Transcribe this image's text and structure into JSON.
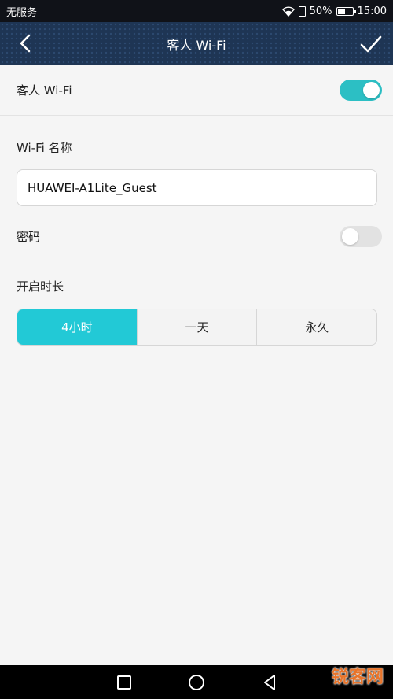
{
  "status_bar": {
    "carrier": "无服务",
    "battery_percent": "50%",
    "time": "15:00",
    "battery_level": 0.5
  },
  "app_bar": {
    "title": "客人 Wi-Fi",
    "back_icon": "chevron-left-icon",
    "confirm_icon": "check-icon"
  },
  "guest_wifi": {
    "label": "客人 Wi-Fi",
    "enabled": true
  },
  "ssid": {
    "label": "Wi-Fi 名称",
    "value": "HUAWEI-A1Lite_Guest"
  },
  "password": {
    "label": "密码",
    "enabled": false
  },
  "duration": {
    "label": "开启时长",
    "options": [
      "4小时",
      "一天",
      "永久"
    ],
    "selected": "4小时"
  },
  "colors": {
    "accent": "#22c9d6",
    "toggle_on": "#2cbfc4",
    "appbar": "#1e3554"
  },
  "nav_bar": {
    "icons": [
      "square-icon",
      "circle-icon",
      "triangle-back-icon"
    ]
  },
  "watermark": "锐客网"
}
